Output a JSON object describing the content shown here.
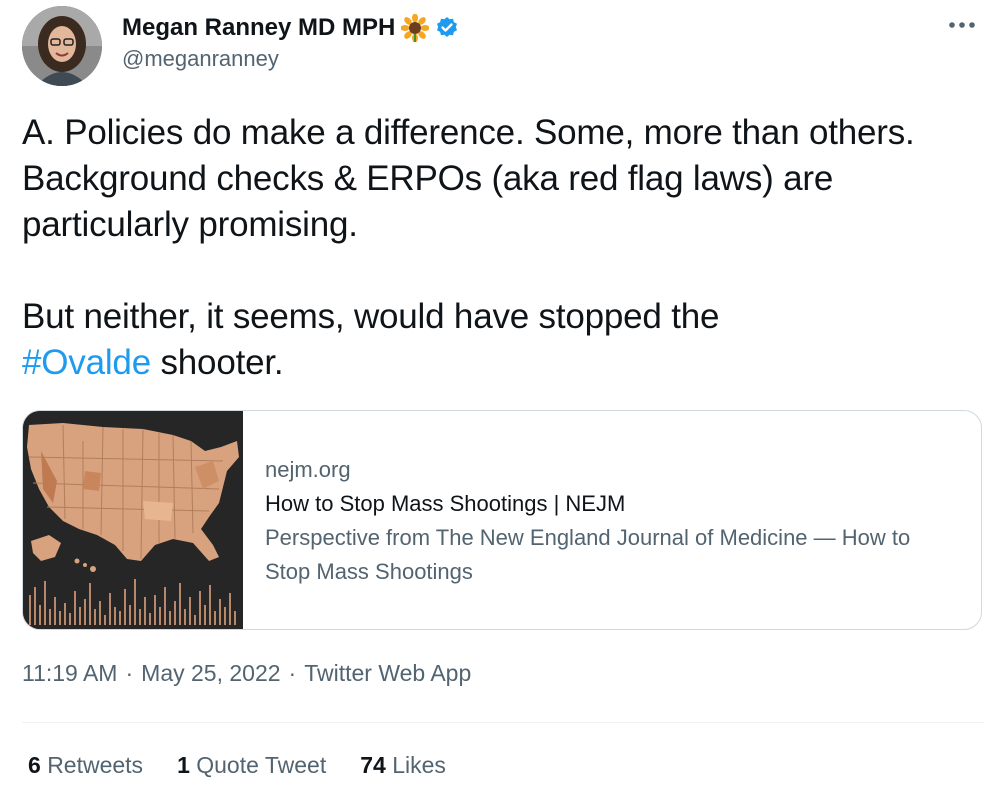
{
  "author": {
    "display_name": "Megan Ranney MD MPH",
    "handle": "@meganranney",
    "emoji_icon": "sunflower-icon",
    "verified_icon": "verified-badge-icon",
    "verified_color": "#1d9bf0"
  },
  "more_icon": "more-horizontal-icon",
  "tweet": {
    "paragraph_1": "A. Policies do make a difference. Some, more than others. Background checks & ERPOs (aka red flag laws) are particularly promising.",
    "paragraph_2_before": "But neither, it seems, would have stopped the",
    "hashtag": "#Ovalde",
    "paragraph_2_after": " shooter."
  },
  "card": {
    "domain": "nejm.org",
    "title": "How to Stop Mass Shootings | NEJM",
    "description": "Perspective from The New England Journal of Medicine — How to Stop Mass Shootings",
    "image": "us-map-thumbnail"
  },
  "meta": {
    "time": "11:19 AM",
    "date": "May 25, 2022",
    "source": "Twitter Web App",
    "separator": "·"
  },
  "stats": {
    "retweets_count": "6",
    "retweets_label": "Retweets",
    "quotes_count": "1",
    "quotes_label": "Quote Tweet",
    "likes_count": "74",
    "likes_label": "Likes"
  },
  "colors": {
    "link": "#1d9bf0",
    "secondary_text": "#536471",
    "border": "#cfd9de"
  }
}
